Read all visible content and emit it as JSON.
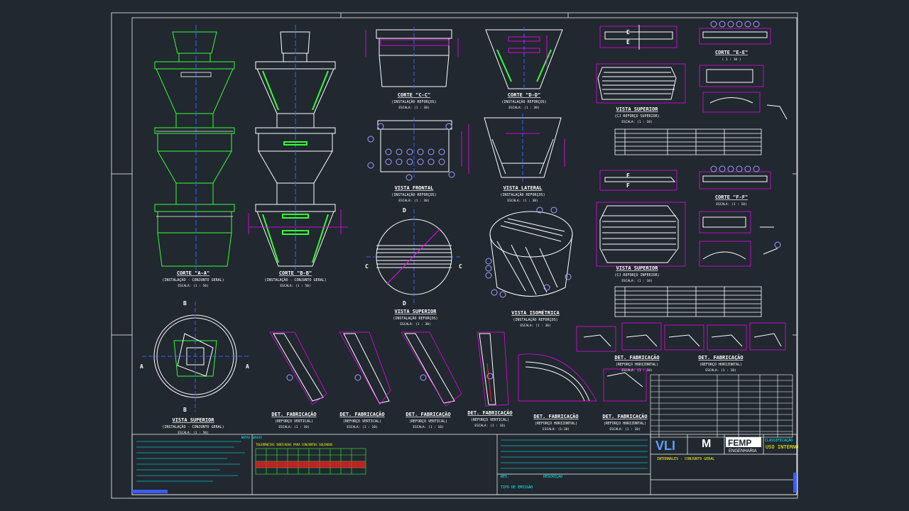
{
  "colors": {
    "background": "#212830",
    "frame": "#c8c8c8",
    "green": "#33ff33",
    "white": "#ffffff",
    "magenta": "#ff00ff",
    "blue": "#3a5cff",
    "cyan": "#00ffff",
    "yellow": "#ffff00",
    "red": "#ff2020"
  },
  "views": {
    "corte_aa": {
      "title": "CORTE \"A-A\"",
      "sub": "(INSTALAÇÃO - CONJUNTO GERAL)",
      "scale": "ESCALA: (1 : 50)"
    },
    "corte_bb": {
      "title": "CORTE \"B-B\"",
      "sub": "(INSTALAÇÃO - CONJUNTO GERAL)",
      "scale": "ESCALA: (1 : 50)"
    },
    "corte_cc": {
      "title": "CORTE \"C-C\"",
      "sub": "(INSTALAÇÃO REFORÇOS)",
      "scale": "ESCALA: (1 : 30)"
    },
    "corte_dd": {
      "title": "CORTE \"D-D\"",
      "sub": "(INSTALAÇÃO REFORÇOS)",
      "scale": "ESCALA: (1 : 30)"
    },
    "vista_frontal": {
      "title": "VISTA FRONTAL",
      "sub": "(INSTALAÇÃO REFORÇOS)",
      "scale": "ESCALA: (1 : 30)"
    },
    "vista_lateral": {
      "title": "VISTA LATERAL",
      "sub": "(INSTALAÇÃO REFORÇOS)",
      "scale": "ESCALA: (1 : 30)"
    },
    "vista_superior_c": {
      "title": "VISTA SUPERIOR",
      "sub": "(INSTALAÇÃO REFORÇOS)",
      "scale": "ESCALA: (1 : 30)"
    },
    "vista_isometrica": {
      "title": "VISTA ISOMÉTRICA",
      "sub": "(INSTALAÇÃO REFORÇOS)",
      "scale": "ESCALA: (1 : 30)"
    },
    "vista_superior_a": {
      "title": "VISTA SUPERIOR",
      "sub": "(INSTALAÇÃO - CONJUNTO GERAL)",
      "scale": "ESCALA: (1 : 50)"
    },
    "vista_superior_ref_sup": {
      "title": "VISTA SUPERIOR",
      "sub": "(CJ REFORÇO SUPERIOR)",
      "scale": "ESCALA: (1 : 10)"
    },
    "vista_superior_ref_inf": {
      "title": "VISTA SUPERIOR",
      "sub": "(CJ REFORÇO INFERIOR)",
      "scale": "ESCALA: (1 : 10)"
    },
    "corte_ee": {
      "title": "CORTE \"E-E\"",
      "scale": "( 1 : 10 )"
    },
    "corte_ff": {
      "title": "CORTE \"F-F\"",
      "scale": "ESCALA: (1 : 10)"
    },
    "det_fab_1": {
      "title": "DET. FABRICAÇÃO",
      "sub": "(REFORÇO VERTICAL)",
      "scale": "ESCALA: (1 : 10)"
    },
    "det_fab_2": {
      "title": "DET. FABRICAÇÃO",
      "sub": "(REFORÇO VERTICAL)",
      "scale": "ESCALA: (1 : 10)"
    },
    "det_fab_3": {
      "title": "DET. FABRICAÇÃO",
      "sub": "(REFORÇO VERTICAL)",
      "scale": "ESCALA: (1 : 10)"
    },
    "det_fab_4": {
      "title": "DET. FABRICAÇÃO",
      "sub": "(REFORÇO VERTICAL)",
      "scale": "ESCALA: (1 : 10)"
    },
    "det_fab_5": {
      "title": "DET. FABRICAÇÃO",
      "sub": "(REFORÇO HORIZONTAL)",
      "scale": "ESCALA: (1:10)"
    },
    "det_fab_6": {
      "title": "DET. FABRICAÇÃO",
      "sub": "(REFORÇO HORIZONTAL)",
      "scale": "ESCALA: (1 : 10)"
    },
    "det_fab_7": {
      "title": "DET. FABRICAÇÃO",
      "sub": "(REFORÇO HORIZONTAL)",
      "scale": "ESCALA: (1 : 10)"
    },
    "det_fab_8": {
      "title": "DET. FABRICAÇÃO",
      "sub": "(REFORÇO HORIZONTAL)",
      "scale": "ESCALA: (1 : 10)"
    }
  },
  "section_marks": {
    "a": "A",
    "b": "B",
    "c": "C",
    "d": "D",
    "e": "E",
    "f": "F"
  },
  "title_block": {
    "logo_vli": "VLI",
    "logo_m": "M",
    "logo_femp": "FEMP",
    "logo_femp_sub": "ENGENHARIA",
    "classification": "CLASSIFICAÇÃO",
    "classification_value": "USO INTERNO",
    "drawing_title": "INTERNALES - CONJUNTO GERAL",
    "rev_header": "REV.",
    "desc_header": "DESCRIÇÃO",
    "issue_label": "TIPO DE EMISSÃO",
    "notes_title": "NOTAS GERAIS",
    "table_title": "TOLERÂNCIAS INDICADAS PARA CONJUNTOS SOLDADOS"
  }
}
